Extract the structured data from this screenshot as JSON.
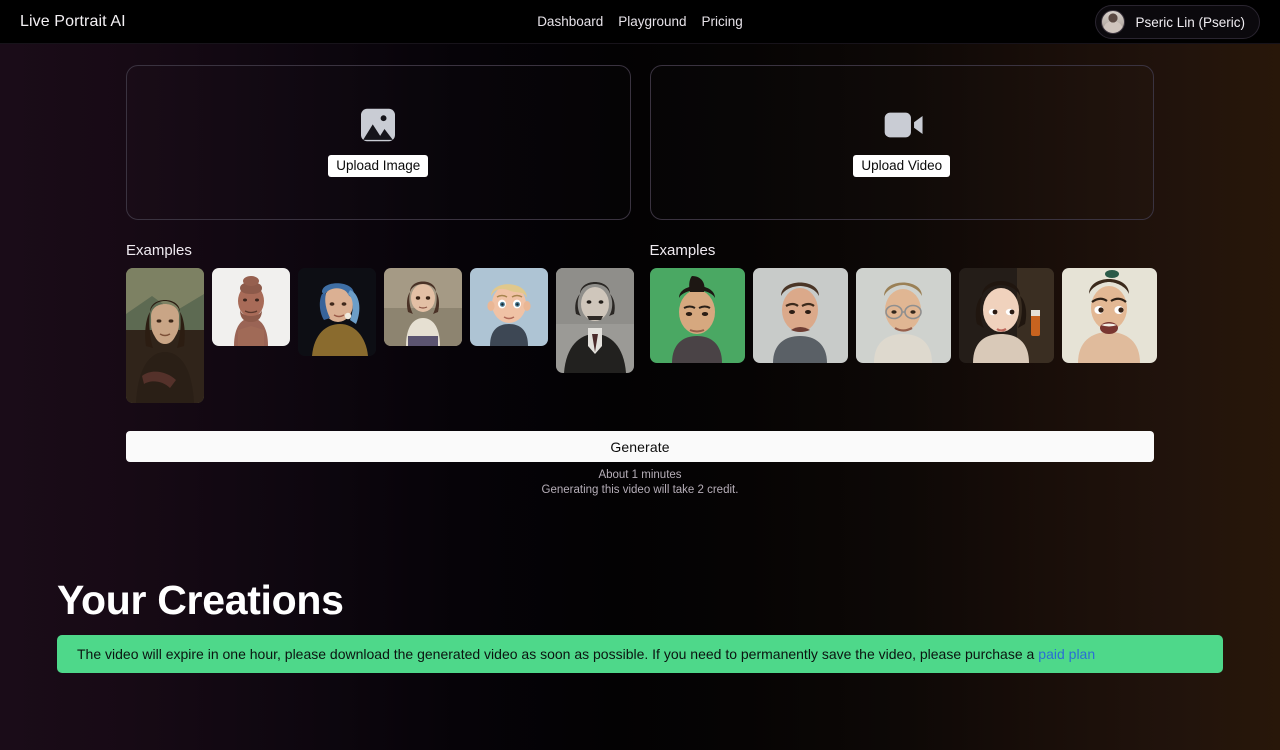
{
  "nav": {
    "brand": "Live Portrait AI",
    "links": [
      {
        "label": "Dashboard",
        "name": "nav-link-dashboard"
      },
      {
        "label": "Playground",
        "name": "nav-link-playground"
      },
      {
        "label": "Pricing",
        "name": "nav-link-pricing"
      }
    ],
    "user": {
      "name": "Pseric Lin (Pseric)",
      "avatar_icon": "user-avatar-photo"
    }
  },
  "image_panel": {
    "icon": "image-placeholder-icon",
    "upload_label": "Upload Image",
    "examples_title": "Examples",
    "examples": [
      {
        "name": "example-image-mona-lisa",
        "alt": "Mona Lisa",
        "w": 78,
        "h": 135
      },
      {
        "name": "example-image-terracotta-warrior",
        "alt": "Terracotta Warrior",
        "w": 78,
        "h": 78
      },
      {
        "name": "example-image-girl-pearl-earring",
        "alt": "Girl with Pearl Earring",
        "w": 78,
        "h": 88
      },
      {
        "name": "example-image-bouguereau-child",
        "alt": "Bouguereau Child",
        "w": 78,
        "h": 78
      },
      {
        "name": "example-image-cartoon-boy",
        "alt": "3D Cartoon Boy",
        "w": 78,
        "h": 78
      },
      {
        "name": "example-image-einstein",
        "alt": "Albert Einstein",
        "w": 78,
        "h": 105
      }
    ]
  },
  "video_panel": {
    "icon": "video-camera-icon",
    "upload_label": "Upload Video",
    "examples_title": "Examples",
    "examples": [
      {
        "name": "example-video-green-screen-man",
        "alt": "Man on green screen",
        "w": 95,
        "h": 95
      },
      {
        "name": "example-video-grimacing-man",
        "alt": "Man grimacing",
        "w": 95,
        "h": 95
      },
      {
        "name": "example-video-glasses-man",
        "alt": "Man with glasses",
        "w": 95,
        "h": 95
      },
      {
        "name": "example-video-asian-woman",
        "alt": "Woman looking aside",
        "w": 95,
        "h": 95
      },
      {
        "name": "example-video-surprised-woman",
        "alt": "Surprised woman",
        "w": 95,
        "h": 95
      }
    ]
  },
  "generate": {
    "label": "Generate",
    "eta": "About 1 minutes",
    "credits": "Generating this video will take 2 credit."
  },
  "creations": {
    "title": "Your Creations",
    "banner_text": "The video will expire in one hour, please download the generated video as soon as possible. If you need to permanently save the video, please purchase a",
    "banner_link": "paid plan",
    "banner_color": "#4ed88a",
    "banner_link_color": "#2b6fd4"
  }
}
